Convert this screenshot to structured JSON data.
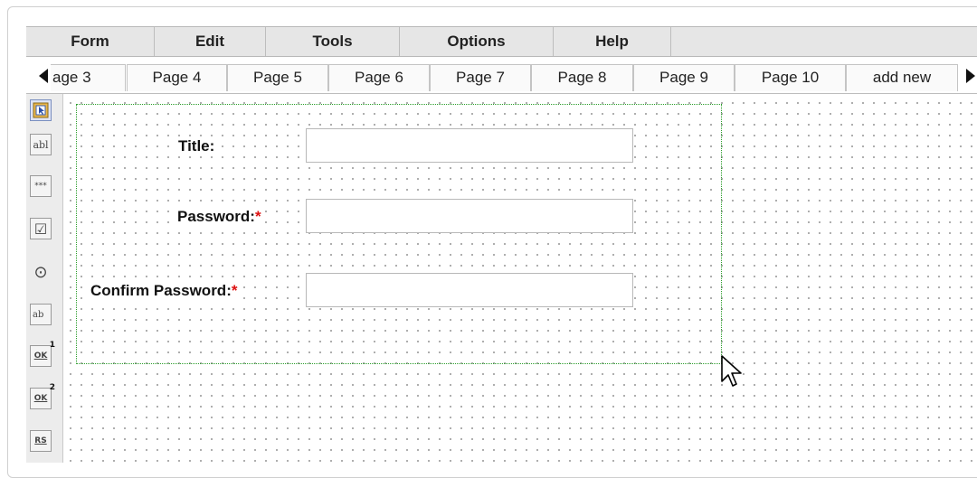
{
  "menu": {
    "items": [
      {
        "label": "Form"
      },
      {
        "label": "Edit"
      },
      {
        "label": "Tools"
      },
      {
        "label": "Options"
      },
      {
        "label": "Help"
      }
    ]
  },
  "tabs": {
    "items": [
      {
        "label": "age 3"
      },
      {
        "label": "Page 4"
      },
      {
        "label": "Page 5"
      },
      {
        "label": "Page 6"
      },
      {
        "label": "Page 7"
      },
      {
        "label": "Page 8"
      },
      {
        "label": "Page 9"
      },
      {
        "label": "Page 10"
      },
      {
        "label": "add new"
      }
    ]
  },
  "toolbox": {
    "tools": [
      {
        "icon": "select-pointer-icon",
        "text": "",
        "selected": true
      },
      {
        "icon": "text-field-icon",
        "text": "abl"
      },
      {
        "icon": "password-field-icon",
        "text": "***"
      },
      {
        "icon": "checkbox-icon",
        "text": "☑"
      },
      {
        "icon": "radio-icon",
        "text": "⊙"
      },
      {
        "icon": "textarea-icon",
        "text": "ab"
      },
      {
        "icon": "button-1-icon",
        "text": "OK",
        "sup": "1"
      },
      {
        "icon": "button-2-icon",
        "text": "OK",
        "sup": "2"
      },
      {
        "icon": "reset-button-icon",
        "text": "RS"
      }
    ]
  },
  "form": {
    "fields": [
      {
        "label": "Title:",
        "required": false,
        "value": ""
      },
      {
        "label": "Password:",
        "required": true,
        "value": ""
      },
      {
        "label": "Confirm Password:",
        "required": true,
        "value": ""
      }
    ],
    "required_marker": "*"
  }
}
